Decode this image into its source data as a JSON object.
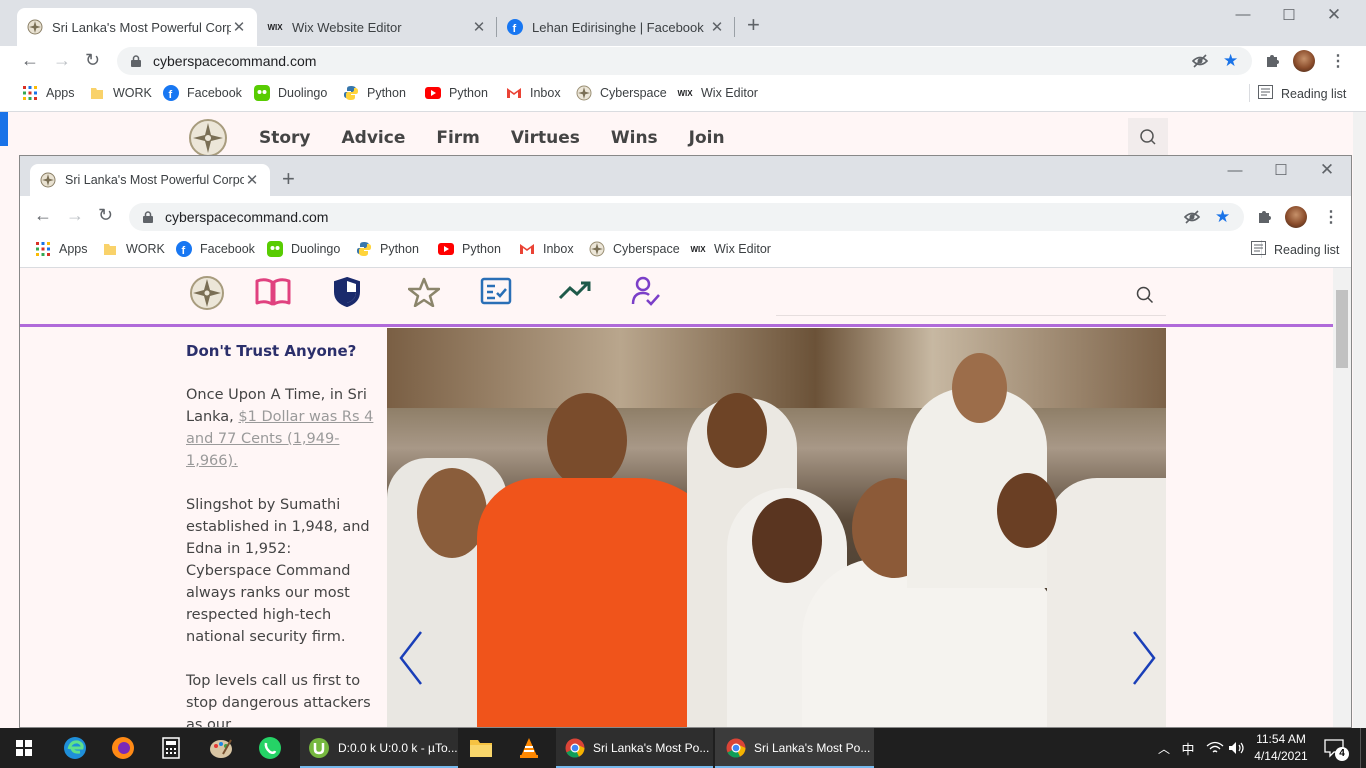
{
  "outer_window": {
    "tabs": [
      {
        "title": "Sri Lanka's Most Powerful Corpor",
        "favicon": "cyberspace-star-icon"
      },
      {
        "title": "Wix Website Editor",
        "favicon": "wix-icon"
      },
      {
        "title": "Lehan Edirisinghe | Facebook",
        "favicon": "facebook-icon"
      }
    ],
    "url": "cyberspacecommand.com",
    "bookmarks": [
      {
        "label": "Apps",
        "icon": "apps-grid-icon"
      },
      {
        "label": "WORK",
        "icon": "folder-icon"
      },
      {
        "label": "Facebook",
        "icon": "facebook-icon"
      },
      {
        "label": "Duolingo",
        "icon": "duolingo-icon"
      },
      {
        "label": "Python",
        "icon": "python-icon"
      },
      {
        "label": "Python",
        "icon": "youtube-icon"
      },
      {
        "label": "Inbox",
        "icon": "gmail-icon"
      },
      {
        "label": "Cyberspace",
        "icon": "cyberspace-star-icon"
      },
      {
        "label": "Wix Editor",
        "icon": "wix-icon"
      }
    ],
    "reading_list": "Reading list",
    "site_nav": [
      "Story",
      "Advice",
      "Firm",
      "Virtues",
      "Wins",
      "Join"
    ]
  },
  "inner_window": {
    "tab_title": "Sri Lanka's Most Powerful Corpor",
    "url": "cyberspacecommand.com",
    "bookmarks": [
      {
        "label": "Apps",
        "icon": "apps-grid-icon"
      },
      {
        "label": "WORK",
        "icon": "folder-icon"
      },
      {
        "label": "Facebook",
        "icon": "facebook-icon"
      },
      {
        "label": "Duolingo",
        "icon": "duolingo-icon"
      },
      {
        "label": "Python",
        "icon": "python-icon"
      },
      {
        "label": "Python",
        "icon": "youtube-icon"
      },
      {
        "label": "Inbox",
        "icon": "gmail-icon"
      },
      {
        "label": "Cyberspace",
        "icon": "cyberspace-star-icon"
      },
      {
        "label": "Wix Editor",
        "icon": "wix-icon"
      }
    ],
    "reading_list": "Reading list",
    "nav_icons": [
      "book-icon",
      "shield-icon",
      "star-icon",
      "checklist-icon",
      "trend-up-icon",
      "user-check-icon"
    ],
    "article": {
      "heading": "Don't Trust Anyone?",
      "p1_text": "Once Upon A Time, in Sri Lanka,",
      "p1_link": "$1 Dollar was Rs 4 and 77 Cents (1,949-1,966).",
      "p2": "Slingshot by Sumathi established in 1,948, and Edna in 1,952: Cyberspace Command always ranks our most respected high-tech national security firm.",
      "p3": "Top levels call us first to stop dangerous attackers as our"
    },
    "colors": {
      "accent_purple": "#b06ad9",
      "heading_navy": "#2b2f6b",
      "page_bg": "#fff6f6"
    }
  },
  "taskbar": {
    "apps": [
      {
        "label": "D:0.0 k U:0.0 k - µTo...",
        "icon": "utorrent-icon"
      },
      {
        "label": "Sri Lanka's Most Po...",
        "icon": "chrome-icon"
      },
      {
        "label": "Sri Lanka's Most Po...",
        "icon": "chrome-icon"
      }
    ],
    "time": "11:54 AM",
    "date": "4/14/2021",
    "notifications": "4",
    "ime": "中"
  }
}
